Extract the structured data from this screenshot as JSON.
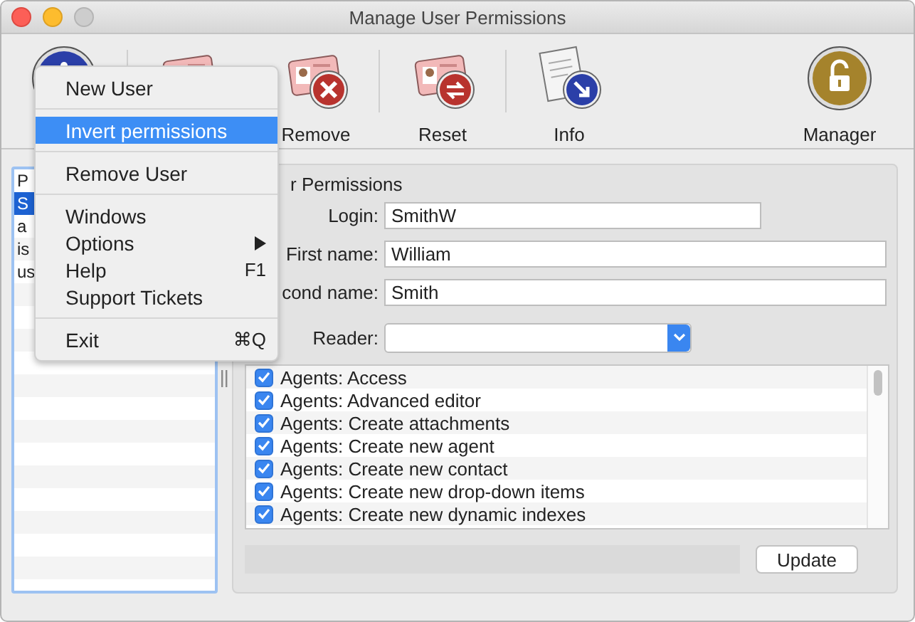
{
  "window": {
    "title": "Manage User Permissions"
  },
  "toolbar": [
    {
      "kind": "info"
    },
    {
      "kind": "separator"
    },
    {
      "kind": "add"
    },
    {
      "kind": "remove",
      "label": "Remove"
    },
    {
      "kind": "separator"
    },
    {
      "kind": "reset",
      "label": "Reset"
    },
    {
      "kind": "separator"
    },
    {
      "kind": "document",
      "label": "Info"
    },
    {
      "kind": "spacer"
    },
    {
      "kind": "lock",
      "label": "Manager"
    }
  ],
  "users": [
    {
      "name": "P",
      "selected": false
    },
    {
      "name": "S",
      "selected": true
    },
    {
      "name": "a",
      "selected": false
    },
    {
      "name": "is",
      "selected": false
    },
    {
      "name": "us",
      "selected": false
    }
  ],
  "group": {
    "title": "r Permissions",
    "fields": [
      {
        "label": "Login:",
        "value": "SmithW"
      },
      {
        "label": "First name:",
        "value": "William"
      },
      {
        "label": "cond name:",
        "value": "Smith"
      }
    ],
    "reader": {
      "label": "Reader:"
    },
    "permissions": [
      {
        "label": "Agents: Access",
        "checked": true
      },
      {
        "label": "Agents: Advanced editor",
        "checked": true
      },
      {
        "label": "Agents: Create attachments",
        "checked": true
      },
      {
        "label": "Agents: Create new agent",
        "checked": true
      },
      {
        "label": "Agents: Create new contact",
        "checked": true
      },
      {
        "label": "Agents: Create new drop-down items",
        "checked": true
      },
      {
        "label": "Agents: Create new dynamic indexes",
        "checked": true
      }
    ],
    "update_button": "Update"
  },
  "menu": {
    "items": [
      {
        "kind": "item",
        "label": "New User",
        "selected": false
      },
      {
        "kind": "separator"
      },
      {
        "kind": "item",
        "label": "Invert permissions",
        "selected": true
      },
      {
        "kind": "separator"
      },
      {
        "kind": "item",
        "label": "Remove User",
        "selected": false
      },
      {
        "kind": "separator"
      },
      {
        "kind": "item",
        "label": "Windows",
        "selected": false
      },
      {
        "kind": "item",
        "label": "Options",
        "selected": false,
        "submenu": true
      },
      {
        "kind": "item",
        "label": "Help",
        "selected": false,
        "shortcut": "F1"
      },
      {
        "kind": "item",
        "label": "Support Tickets",
        "selected": false
      },
      {
        "kind": "separator"
      },
      {
        "kind": "item",
        "label": "Exit",
        "selected": false,
        "shortcut": "⌘Q"
      }
    ]
  }
}
